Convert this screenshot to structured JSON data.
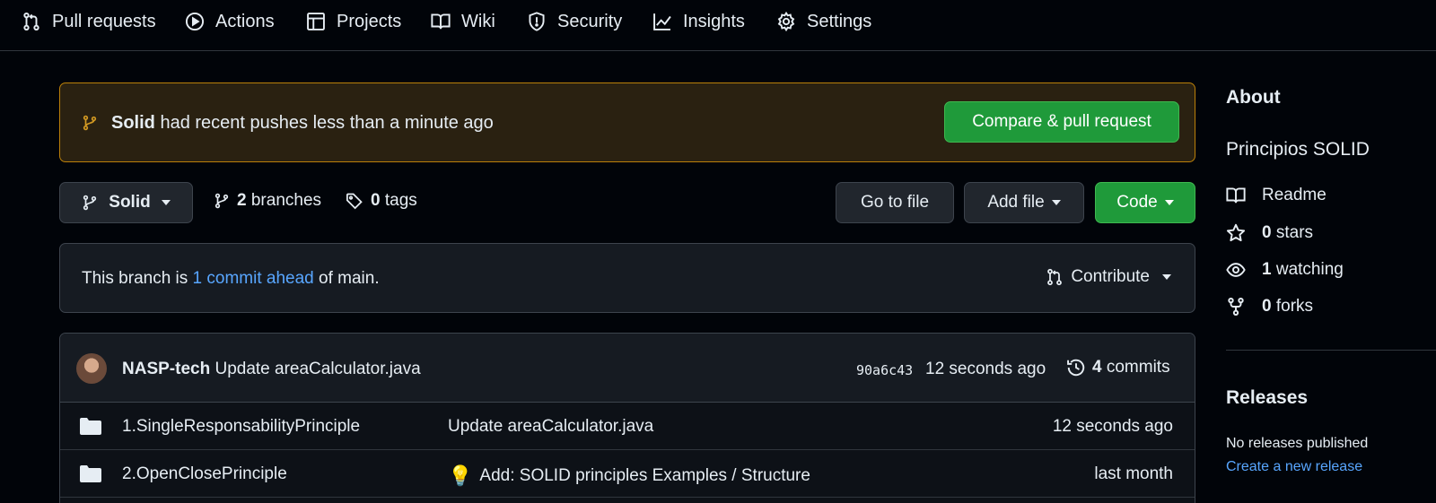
{
  "nav": {
    "items": [
      {
        "label": "Pull requests",
        "icon": "pull-request-icon"
      },
      {
        "label": "Actions",
        "icon": "play-icon"
      },
      {
        "label": "Projects",
        "icon": "table-icon"
      },
      {
        "label": "Wiki",
        "icon": "book-icon"
      },
      {
        "label": "Security",
        "icon": "shield-icon"
      },
      {
        "label": "Insights",
        "icon": "graph-icon"
      },
      {
        "label": "Settings",
        "icon": "gear-icon"
      }
    ]
  },
  "banner": {
    "branch": "Solid",
    "message": " had recent pushes less than a minute ago",
    "button": "Compare & pull request",
    "accent": "#bb8009"
  },
  "toolbar": {
    "branch_select": "Solid",
    "branches_count": "2",
    "branches_label": " branches",
    "tags_count": "0",
    "tags_label": " tags",
    "go_to_file": "Go to file",
    "add_file": "Add file",
    "code": "Code",
    "code_color": "#1f9a3a"
  },
  "ahead": {
    "prefix": "This branch is ",
    "link": "1 commit ahead",
    "suffix": " of main.",
    "contribute": "Contribute"
  },
  "latest_commit": {
    "author": "NASP-tech",
    "message": " Update areaCalculator.java",
    "sha": "90a6c43",
    "time": "12 seconds ago",
    "commits_count": "4",
    "commits_label": " commits"
  },
  "files": [
    {
      "name": "1.SingleResponsabilityPrinciple",
      "message": "Update areaCalculator.java",
      "emoji": "",
      "time": "12 seconds ago"
    },
    {
      "name": "2.OpenClosePrinciple",
      "message": "Add: SOLID principles Examples / Structure",
      "emoji": "💡",
      "time": "last month"
    }
  ],
  "sidebar": {
    "about_title": "About",
    "description": "Principios SOLID",
    "readme": "Readme",
    "stars_count": "0",
    "stars_label": " stars",
    "watching_count": "1",
    "watching_label": " watching",
    "forks_count": "0",
    "forks_label": " forks",
    "releases_title": "Releases",
    "no_releases": "No releases published",
    "create_release": "Create a new release",
    "link_color": "#58a6ff"
  }
}
